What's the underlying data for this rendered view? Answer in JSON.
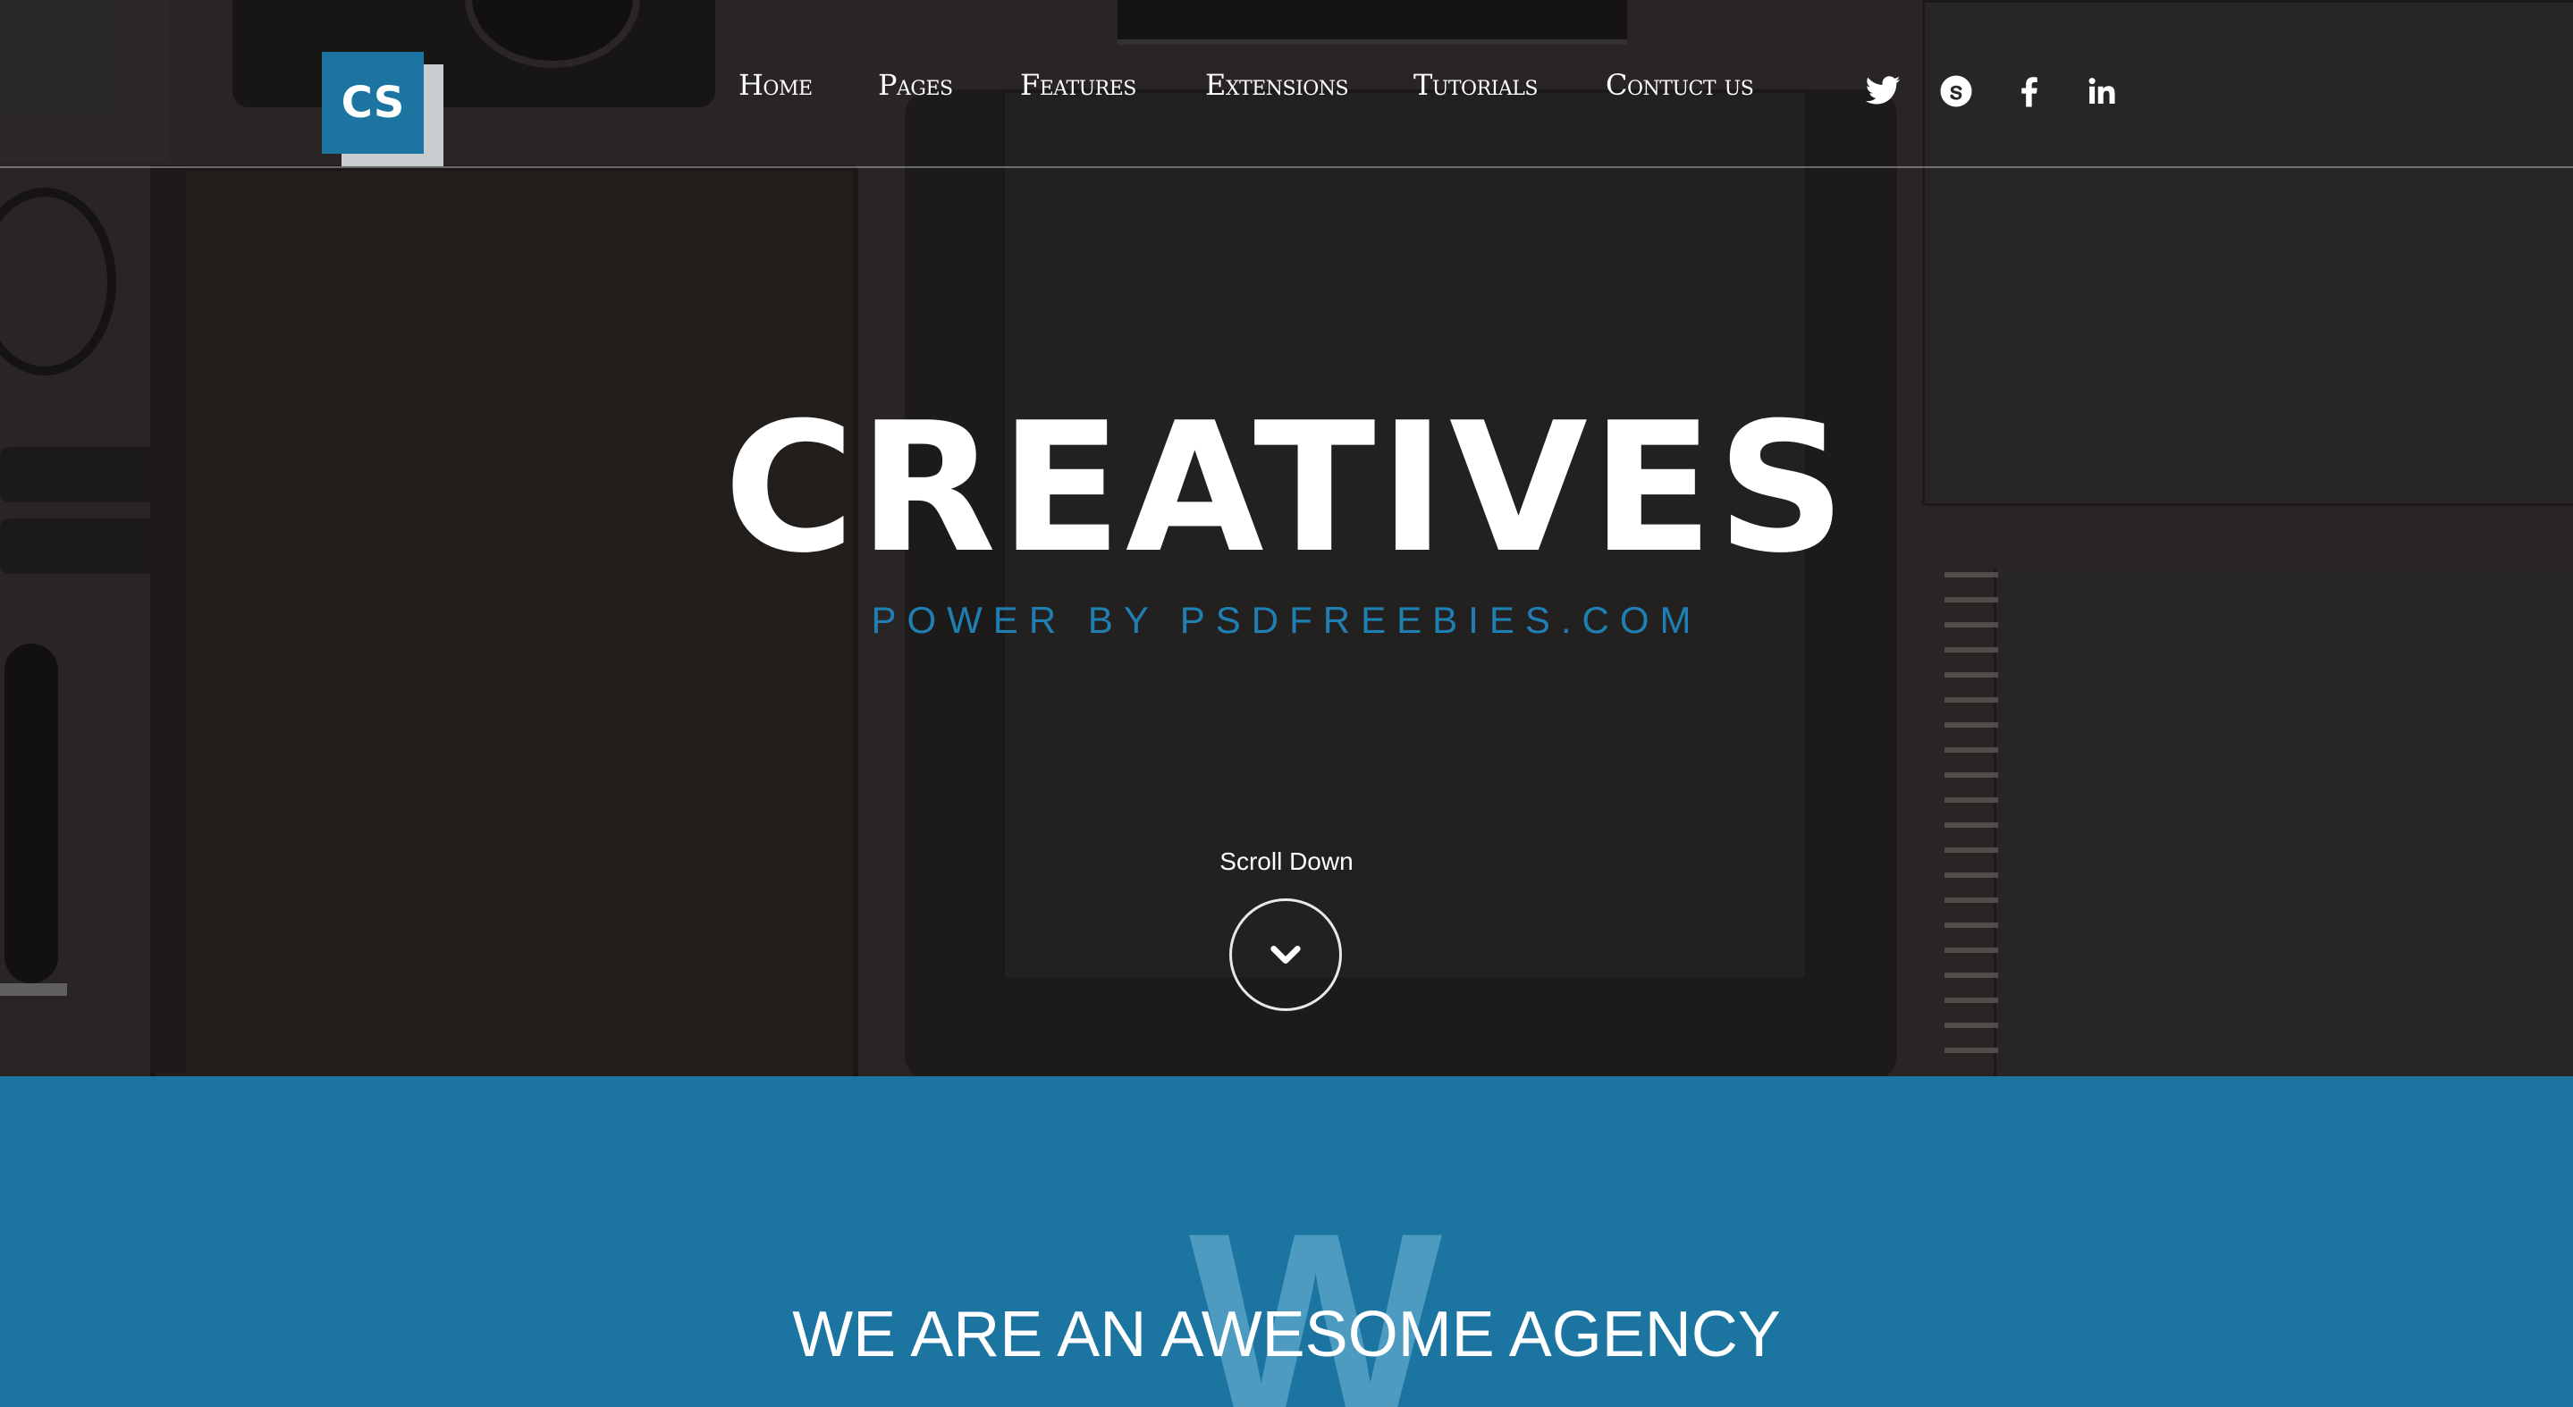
{
  "logo": {
    "text": "CS"
  },
  "nav": {
    "items": [
      "Home",
      "Pages",
      "Features",
      "Extensions",
      "Tutorials",
      "Contuct us"
    ]
  },
  "socials": [
    "twitter-icon",
    "skype-icon",
    "facebook-icon",
    "linkedin-icon"
  ],
  "hero": {
    "title": "CREATIVES",
    "subtitle": "POWER BY PSDFREEBIES.COM",
    "scroll_label": "Scroll Down"
  },
  "about": {
    "watermark": "W",
    "title": "WE ARE AN AWESOME AGENCY"
  },
  "colors": {
    "accent": "#1b75a0",
    "subtitle": "#1f7fb3",
    "hero_bg": "#2b2927"
  }
}
